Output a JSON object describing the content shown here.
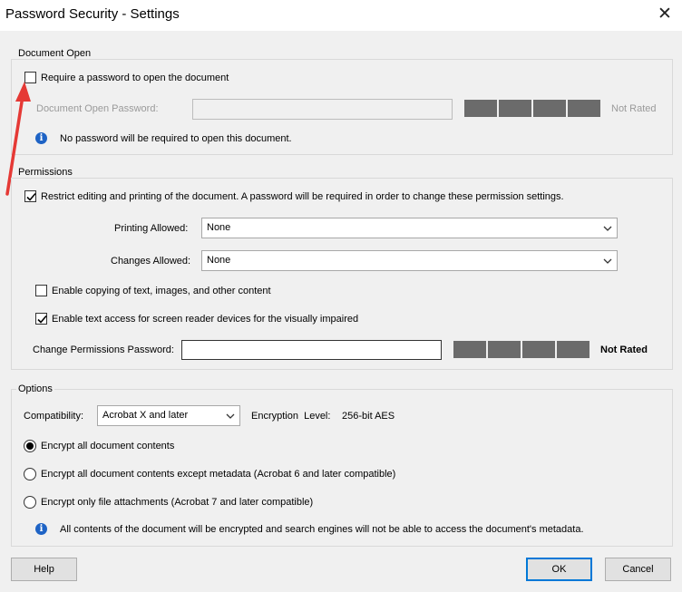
{
  "window": {
    "title": "Password Security - Settings",
    "close_glyph": "✕"
  },
  "document_open": {
    "group_label": "Document Open",
    "require_password_label": "Require a password to open the document",
    "require_password_checked": false,
    "password_label": "Document Open Password:",
    "password_value": "",
    "rating": "Not Rated",
    "info_text": "No password will be required to open this document."
  },
  "permissions": {
    "group_label": "Permissions",
    "restrict_label": "Restrict editing and printing of the document. A password will be required in order to change these permission settings.",
    "restrict_checked": true,
    "printing_label": "Printing Allowed:",
    "printing_value": "None",
    "changes_label": "Changes Allowed:",
    "changes_value": "None",
    "copy_label": "Enable copying of text, images, and other content",
    "copy_checked": false,
    "screenreader_label": "Enable text access for screen reader devices for the visually impaired",
    "screenreader_checked": true,
    "password_label": "Change Permissions Password:",
    "password_value": "",
    "rating": "Not Rated"
  },
  "options": {
    "group_label": "Options",
    "compat_label": "Compatibility:",
    "compat_value": "Acrobat X and later",
    "encryption_label": "Encryption  Level:",
    "encryption_value": "256-bit AES",
    "radio_all": "Encrypt all document contents",
    "radio_except_meta": "Encrypt all document contents except metadata (Acrobat 6 and later compatible)",
    "radio_attachments": "Encrypt only file attachments (Acrobat 7 and later compatible)",
    "selected": "radio_all",
    "info_text": "All contents of the document will be encrypted and search engines will not be able to access the document's metadata."
  },
  "buttons": {
    "help": "Help",
    "ok": "OK",
    "cancel": "Cancel"
  },
  "colors": {
    "accent": "#0078d7",
    "info": "#1e63c5",
    "annotation_arrow": "#e53935",
    "meter": "#6b6b6b"
  }
}
